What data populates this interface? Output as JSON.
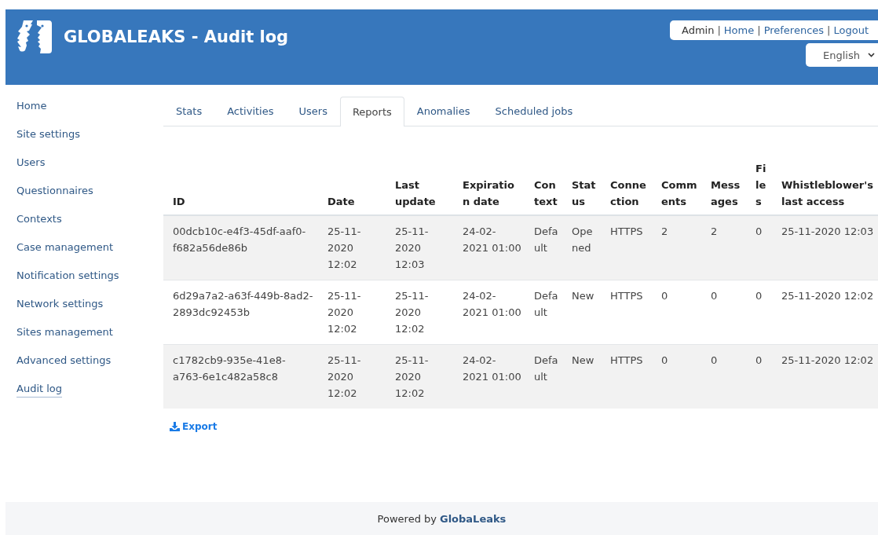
{
  "header": {
    "title": "GLOBALEAKS - Audit log",
    "user_menu": {
      "user": "Admin",
      "separator": "|",
      "links": [
        "Home",
        "Preferences",
        "Logout"
      ]
    },
    "language": {
      "value": "English"
    }
  },
  "sidebar": {
    "items": [
      {
        "label": "Home",
        "selected": false
      },
      {
        "label": "Site settings",
        "selected": false
      },
      {
        "label": "Users",
        "selected": false
      },
      {
        "label": "Questionnaires",
        "selected": false
      },
      {
        "label": "Contexts",
        "selected": false
      },
      {
        "label": "Case management",
        "selected": false
      },
      {
        "label": "Notification settings",
        "selected": false
      },
      {
        "label": "Network settings",
        "selected": false
      },
      {
        "label": "Sites management",
        "selected": false
      },
      {
        "label": "Advanced settings",
        "selected": false
      },
      {
        "label": "Audit log",
        "selected": true
      }
    ]
  },
  "tabs": [
    {
      "label": "Stats",
      "selected": false
    },
    {
      "label": "Activities",
      "selected": false
    },
    {
      "label": "Users",
      "selected": false
    },
    {
      "label": "Reports",
      "selected": true
    },
    {
      "label": "Anomalies",
      "selected": false
    },
    {
      "label": "Scheduled jobs",
      "selected": false
    }
  ],
  "table": {
    "columns": [
      "ID",
      "Date",
      "Last update",
      "Expiration date",
      "Context",
      "Status",
      "Connection",
      "Comments",
      "Messages",
      "Files",
      "Whistleblower's last access"
    ],
    "rows": [
      [
        "00dcb10c-e4f3-45df-aaf0-f682a56de86b",
        "25-11-2020 12:02",
        "25-11-2020 12:03",
        "24-02-2021 01:00",
        "Default",
        "Opened",
        "HTTPS",
        "2",
        "2",
        "0",
        "25-11-2020 12:03"
      ],
      [
        "6d29a7a2-a63f-449b-8ad2-2893dc92453b",
        "25-11-2020 12:02",
        "25-11-2020 12:02",
        "24-02-2021 01:00",
        "Default",
        "New",
        "HTTPS",
        "0",
        "0",
        "0",
        "25-11-2020 12:02"
      ],
      [
        "c1782cb9-935e-41e8-a763-6e1c482a58c8",
        "25-11-2020 12:02",
        "25-11-2020 12:02",
        "24-02-2021 01:00",
        "Default",
        "New",
        "HTTPS",
        "0",
        "0",
        "0",
        "25-11-2020 12:02"
      ]
    ]
  },
  "export_button": {
    "label": "Export"
  },
  "footer": {
    "text": "Powered by",
    "link": "GlobaLeaks"
  }
}
